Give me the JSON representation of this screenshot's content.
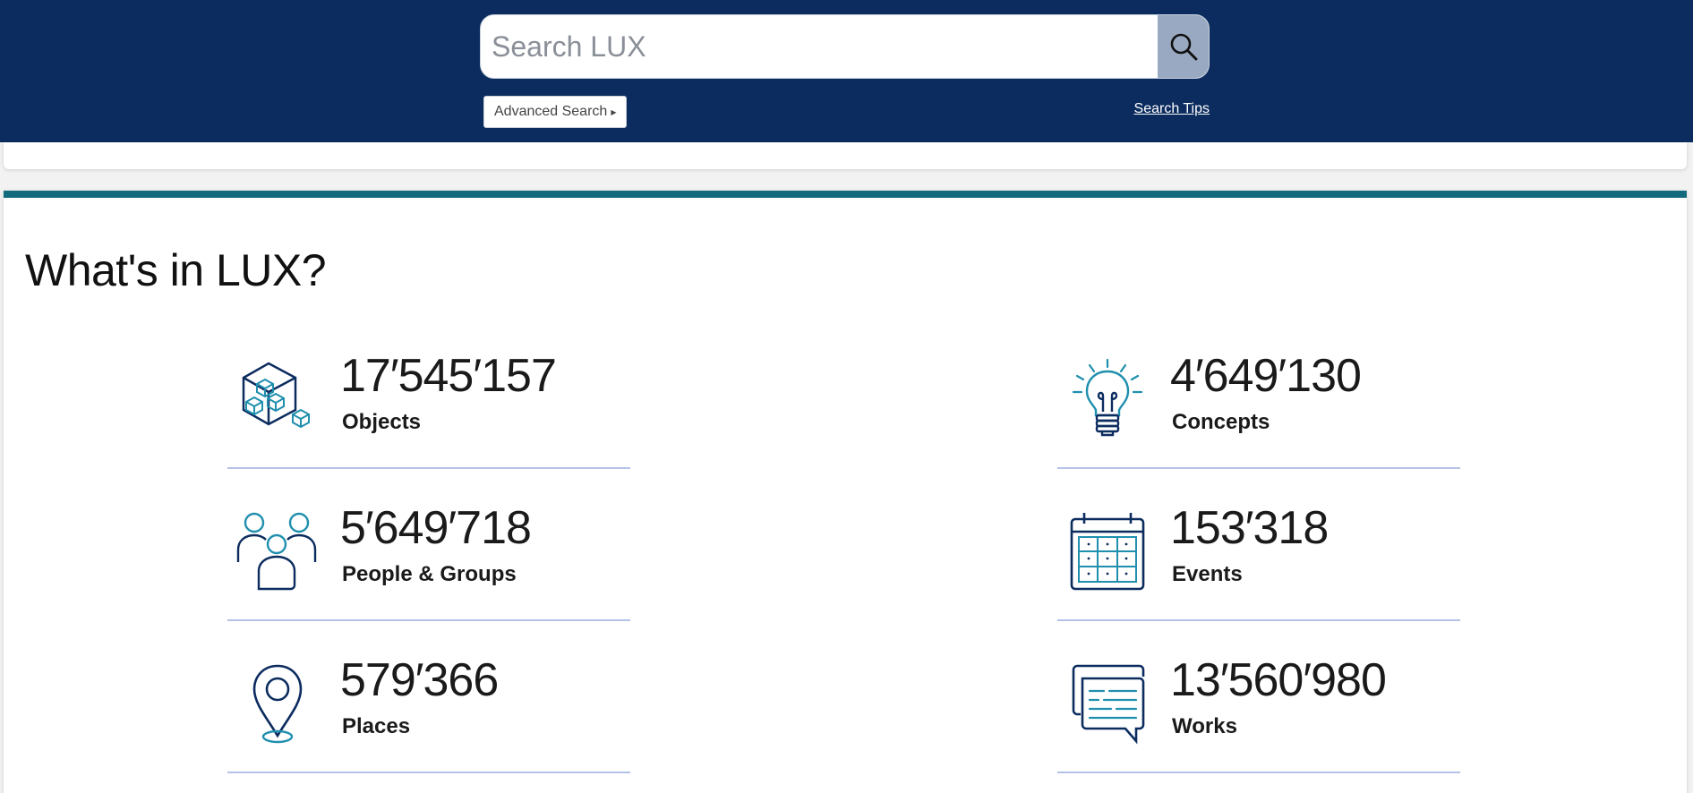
{
  "search": {
    "placeholder": "Search LUX",
    "advanced_label": "Advanced Search",
    "tips_label": "Search Tips"
  },
  "section": {
    "title": "What's in LUX?"
  },
  "stats": [
    {
      "count": "17′545′157",
      "label": "Objects",
      "icon": "objects-icon"
    },
    {
      "count": "4′649′130",
      "label": "Concepts",
      "icon": "concepts-lightbulb-icon"
    },
    {
      "count": "5′649′718",
      "label": "People & Groups",
      "icon": "people-groups-icon"
    },
    {
      "count": "153′318",
      "label": "Events",
      "icon": "events-calendar-icon"
    },
    {
      "count": "579′366",
      "label": "Places",
      "icon": "places-pin-icon"
    },
    {
      "count": "13′560′980",
      "label": "Works",
      "icon": "works-chat-icon"
    }
  ],
  "colors": {
    "header_bg": "#0c2c5f",
    "accent_teal": "#116b7d",
    "icon_navy": "#0c2c5f",
    "icon_teal": "#1f8fae",
    "divider": "#b3c2e6"
  }
}
